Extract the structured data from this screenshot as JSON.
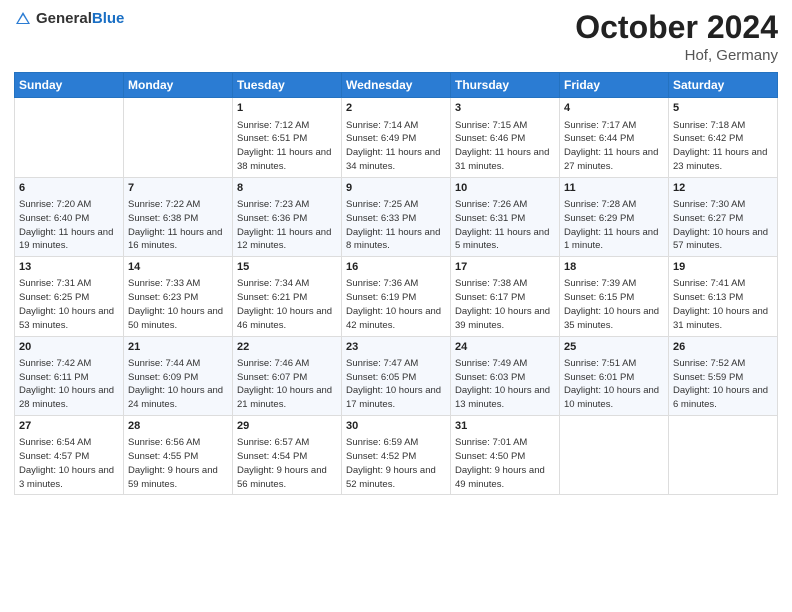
{
  "header": {
    "logo_general": "General",
    "logo_blue": "Blue",
    "month": "October 2024",
    "location": "Hof, Germany"
  },
  "weekdays": [
    "Sunday",
    "Monday",
    "Tuesday",
    "Wednesday",
    "Thursday",
    "Friday",
    "Saturday"
  ],
  "weeks": [
    [
      {
        "day": "",
        "info": ""
      },
      {
        "day": "",
        "info": ""
      },
      {
        "day": "1",
        "info": "Sunrise: 7:12 AM\nSunset: 6:51 PM\nDaylight: 11 hours and 38 minutes."
      },
      {
        "day": "2",
        "info": "Sunrise: 7:14 AM\nSunset: 6:49 PM\nDaylight: 11 hours and 34 minutes."
      },
      {
        "day": "3",
        "info": "Sunrise: 7:15 AM\nSunset: 6:46 PM\nDaylight: 11 hours and 31 minutes."
      },
      {
        "day": "4",
        "info": "Sunrise: 7:17 AM\nSunset: 6:44 PM\nDaylight: 11 hours and 27 minutes."
      },
      {
        "day": "5",
        "info": "Sunrise: 7:18 AM\nSunset: 6:42 PM\nDaylight: 11 hours and 23 minutes."
      }
    ],
    [
      {
        "day": "6",
        "info": "Sunrise: 7:20 AM\nSunset: 6:40 PM\nDaylight: 11 hours and 19 minutes."
      },
      {
        "day": "7",
        "info": "Sunrise: 7:22 AM\nSunset: 6:38 PM\nDaylight: 11 hours and 16 minutes."
      },
      {
        "day": "8",
        "info": "Sunrise: 7:23 AM\nSunset: 6:36 PM\nDaylight: 11 hours and 12 minutes."
      },
      {
        "day": "9",
        "info": "Sunrise: 7:25 AM\nSunset: 6:33 PM\nDaylight: 11 hours and 8 minutes."
      },
      {
        "day": "10",
        "info": "Sunrise: 7:26 AM\nSunset: 6:31 PM\nDaylight: 11 hours and 5 minutes."
      },
      {
        "day": "11",
        "info": "Sunrise: 7:28 AM\nSunset: 6:29 PM\nDaylight: 11 hours and 1 minute."
      },
      {
        "day": "12",
        "info": "Sunrise: 7:30 AM\nSunset: 6:27 PM\nDaylight: 10 hours and 57 minutes."
      }
    ],
    [
      {
        "day": "13",
        "info": "Sunrise: 7:31 AM\nSunset: 6:25 PM\nDaylight: 10 hours and 53 minutes."
      },
      {
        "day": "14",
        "info": "Sunrise: 7:33 AM\nSunset: 6:23 PM\nDaylight: 10 hours and 50 minutes."
      },
      {
        "day": "15",
        "info": "Sunrise: 7:34 AM\nSunset: 6:21 PM\nDaylight: 10 hours and 46 minutes."
      },
      {
        "day": "16",
        "info": "Sunrise: 7:36 AM\nSunset: 6:19 PM\nDaylight: 10 hours and 42 minutes."
      },
      {
        "day": "17",
        "info": "Sunrise: 7:38 AM\nSunset: 6:17 PM\nDaylight: 10 hours and 39 minutes."
      },
      {
        "day": "18",
        "info": "Sunrise: 7:39 AM\nSunset: 6:15 PM\nDaylight: 10 hours and 35 minutes."
      },
      {
        "day": "19",
        "info": "Sunrise: 7:41 AM\nSunset: 6:13 PM\nDaylight: 10 hours and 31 minutes."
      }
    ],
    [
      {
        "day": "20",
        "info": "Sunrise: 7:42 AM\nSunset: 6:11 PM\nDaylight: 10 hours and 28 minutes."
      },
      {
        "day": "21",
        "info": "Sunrise: 7:44 AM\nSunset: 6:09 PM\nDaylight: 10 hours and 24 minutes."
      },
      {
        "day": "22",
        "info": "Sunrise: 7:46 AM\nSunset: 6:07 PM\nDaylight: 10 hours and 21 minutes."
      },
      {
        "day": "23",
        "info": "Sunrise: 7:47 AM\nSunset: 6:05 PM\nDaylight: 10 hours and 17 minutes."
      },
      {
        "day": "24",
        "info": "Sunrise: 7:49 AM\nSunset: 6:03 PM\nDaylight: 10 hours and 13 minutes."
      },
      {
        "day": "25",
        "info": "Sunrise: 7:51 AM\nSunset: 6:01 PM\nDaylight: 10 hours and 10 minutes."
      },
      {
        "day": "26",
        "info": "Sunrise: 7:52 AM\nSunset: 5:59 PM\nDaylight: 10 hours and 6 minutes."
      }
    ],
    [
      {
        "day": "27",
        "info": "Sunrise: 6:54 AM\nSunset: 4:57 PM\nDaylight: 10 hours and 3 minutes."
      },
      {
        "day": "28",
        "info": "Sunrise: 6:56 AM\nSunset: 4:55 PM\nDaylight: 9 hours and 59 minutes."
      },
      {
        "day": "29",
        "info": "Sunrise: 6:57 AM\nSunset: 4:54 PM\nDaylight: 9 hours and 56 minutes."
      },
      {
        "day": "30",
        "info": "Sunrise: 6:59 AM\nSunset: 4:52 PM\nDaylight: 9 hours and 52 minutes."
      },
      {
        "day": "31",
        "info": "Sunrise: 7:01 AM\nSunset: 4:50 PM\nDaylight: 9 hours and 49 minutes."
      },
      {
        "day": "",
        "info": ""
      },
      {
        "day": "",
        "info": ""
      }
    ]
  ]
}
